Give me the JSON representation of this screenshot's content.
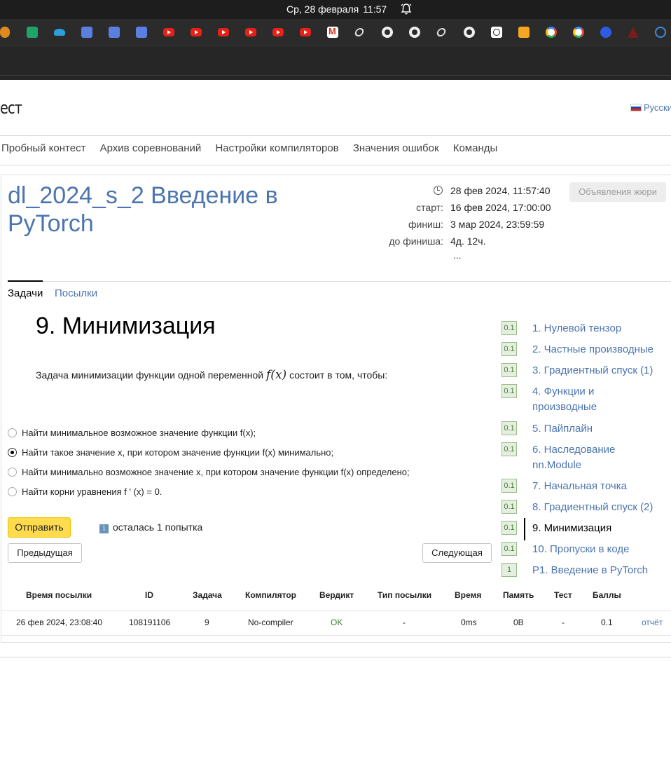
{
  "os": {
    "date": "Ср, 28 февраля",
    "time": "11:57"
  },
  "bookmarks": [
    "oo-icon",
    "sheets-icon",
    "curve-icon",
    "cube-icon",
    "cube-icon",
    "cube-icon",
    "youtube-icon",
    "youtube-icon",
    "youtube-icon",
    "youtube-icon",
    "youtube-icon",
    "youtube-icon",
    "gmail-icon",
    "squarespace-icon",
    "github-icon",
    "github-icon",
    "squarespace-icon",
    "github-icon",
    "clock-app-icon",
    "mail-icon",
    "google-icon",
    "google-icon",
    "zoom-icon",
    "msu-icon",
    "spiral-icon"
  ],
  "site": {
    "logo": "ест",
    "language": "Русски"
  },
  "nav": [
    "Пробный контест",
    "Архив соревнований",
    "Настройки компиляторов",
    "Значения ошибок",
    "Команды"
  ],
  "contest": {
    "title": "dl_2024_s_2 Введение в PyTorch",
    "current_time": "28 фев 2024, 11:57:40",
    "start_label": "старт:",
    "start": "16 фев 2024, 17:00:00",
    "finish_label": "финиш:",
    "finish": "3 мар 2024, 23:59:59",
    "left_label": "до финиша:",
    "left": "4д. 12ч.",
    "more": "...",
    "jury_button": "Объявления жюри"
  },
  "tabs": {
    "tasks": "Задачи",
    "submissions": "Посылки"
  },
  "problem": {
    "title": "9. Минимизация",
    "statement_before": "Задача минимизации функции одной переменной",
    "statement_math": "f(x)",
    "statement_after": "состоит в том, чтобы:",
    "options": [
      {
        "text": "Найти минимальное возможное значение функции f(x);",
        "checked": false
      },
      {
        "text": "Найти такое значение x, при котором значение функции f(x) минимально;",
        "checked": true
      },
      {
        "text": "Найти минимально возможное значение x, при котором значение функции f(x) определено;",
        "checked": false
      },
      {
        "text": "Найти корни уравнения f ' (x) = 0.",
        "checked": false
      }
    ],
    "submit": "Отправить",
    "attempts": "осталась 1 попытка",
    "prev": "Предыдущая",
    "next": "Следующая"
  },
  "problem_list": [
    {
      "score": "0.1",
      "label": "1. Нулевой тензор"
    },
    {
      "score": "0.1",
      "label": "2. Частные производные"
    },
    {
      "score": "0.1",
      "label": "3. Градиентный спуск (1)"
    },
    {
      "score": "0.1",
      "label": "4. Функции и производные"
    },
    {
      "score": "0.1",
      "label": "5. Пайплайн"
    },
    {
      "score": "0.1",
      "label": "6. Наследование nn.Module"
    },
    {
      "score": "0.1",
      "label": "7. Начальная точка"
    },
    {
      "score": "0.1",
      "label": "8. Градиентный спуск (2)"
    },
    {
      "score": "0.1",
      "label": "9. Минимизация"
    },
    {
      "score": "0.1",
      "label": "10. Пропуски в коде"
    },
    {
      "score": "1",
      "label": "P1. Введение в PyTorch"
    }
  ],
  "table": {
    "headers": [
      "Время посылки",
      "ID",
      "Задача",
      "Компилятор",
      "Вердикт",
      "Тип посылки",
      "Время",
      "Память",
      "Тест",
      "Баллы"
    ],
    "rows": [
      [
        "26 фев 2024, 23:08:40",
        "108191106",
        "9",
        "No-compiler",
        "OK",
        "-",
        "0ms",
        "0B",
        "-",
        "0.1",
        "отчёт"
      ]
    ]
  }
}
